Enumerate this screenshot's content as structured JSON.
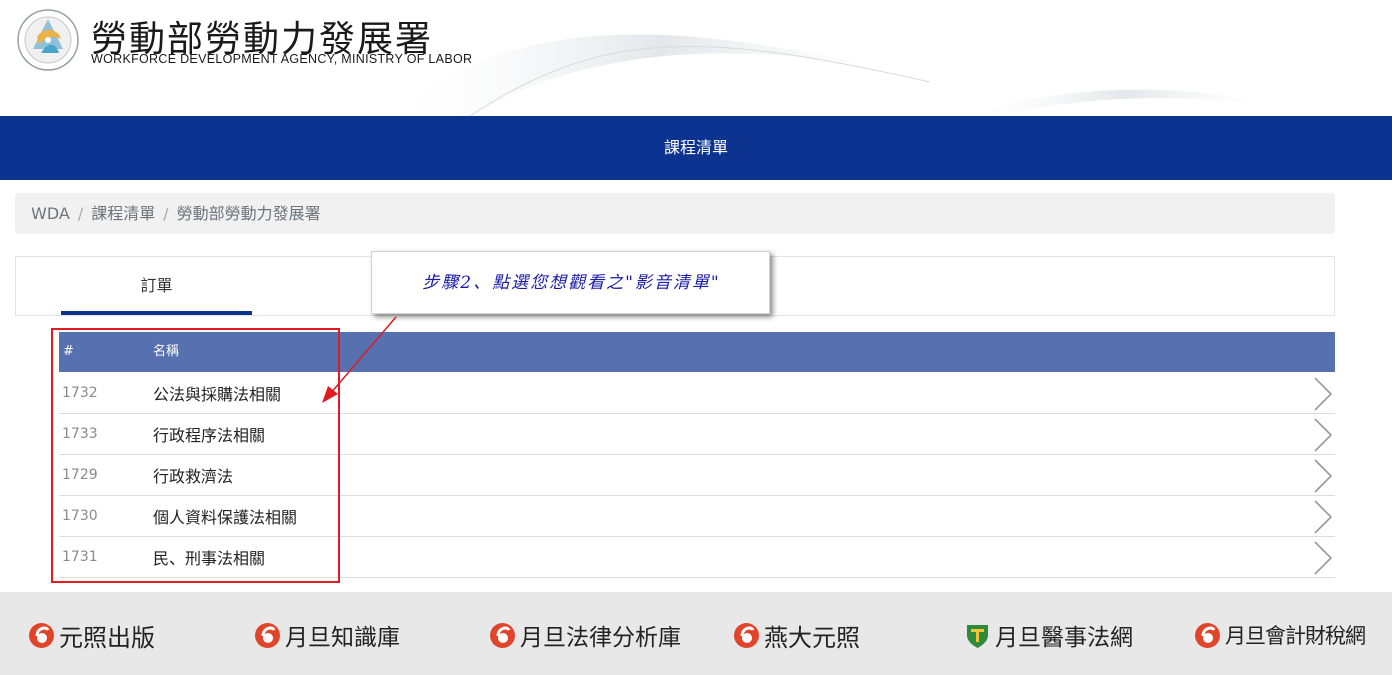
{
  "header": {
    "agency_name_zh": "勞動部勞動力發展署",
    "agency_name_en": "WORKFORCE DEVELOPMENT AGENCY, MINISTRY OF LABOR"
  },
  "navbar": {
    "title": "課程清單"
  },
  "breadcrumb": {
    "items": [
      "WDA",
      "課程清單",
      "勞動部勞動力發展署"
    ],
    "separator": "/"
  },
  "tabs": {
    "active": "訂單"
  },
  "callout": {
    "text": "步驟2、點選您想觀看之\"影音清單\""
  },
  "table": {
    "headers": {
      "num": "#",
      "name": "名稱"
    },
    "rows": [
      {
        "id": "1732",
        "name": "公法與採購法相關"
      },
      {
        "id": "1733",
        "name": "行政程序法相關"
      },
      {
        "id": "1729",
        "name": "行政救濟法"
      },
      {
        "id": "1730",
        "name": "個人資料保護法相關"
      },
      {
        "id": "1731",
        "name": "民、刑事法相關"
      }
    ]
  },
  "footer": {
    "brands": [
      "元照出版",
      "月旦知識庫",
      "月旦法律分析庫",
      "燕大元照",
      "月旦醫事法網",
      "月旦會計財稅網"
    ]
  },
  "colors": {
    "navbar": "#0b338f",
    "table_header": "#5670b0",
    "highlight": "#e11b22",
    "callout_text": "#1a1aa8",
    "brand_icon": "#e0452b"
  }
}
